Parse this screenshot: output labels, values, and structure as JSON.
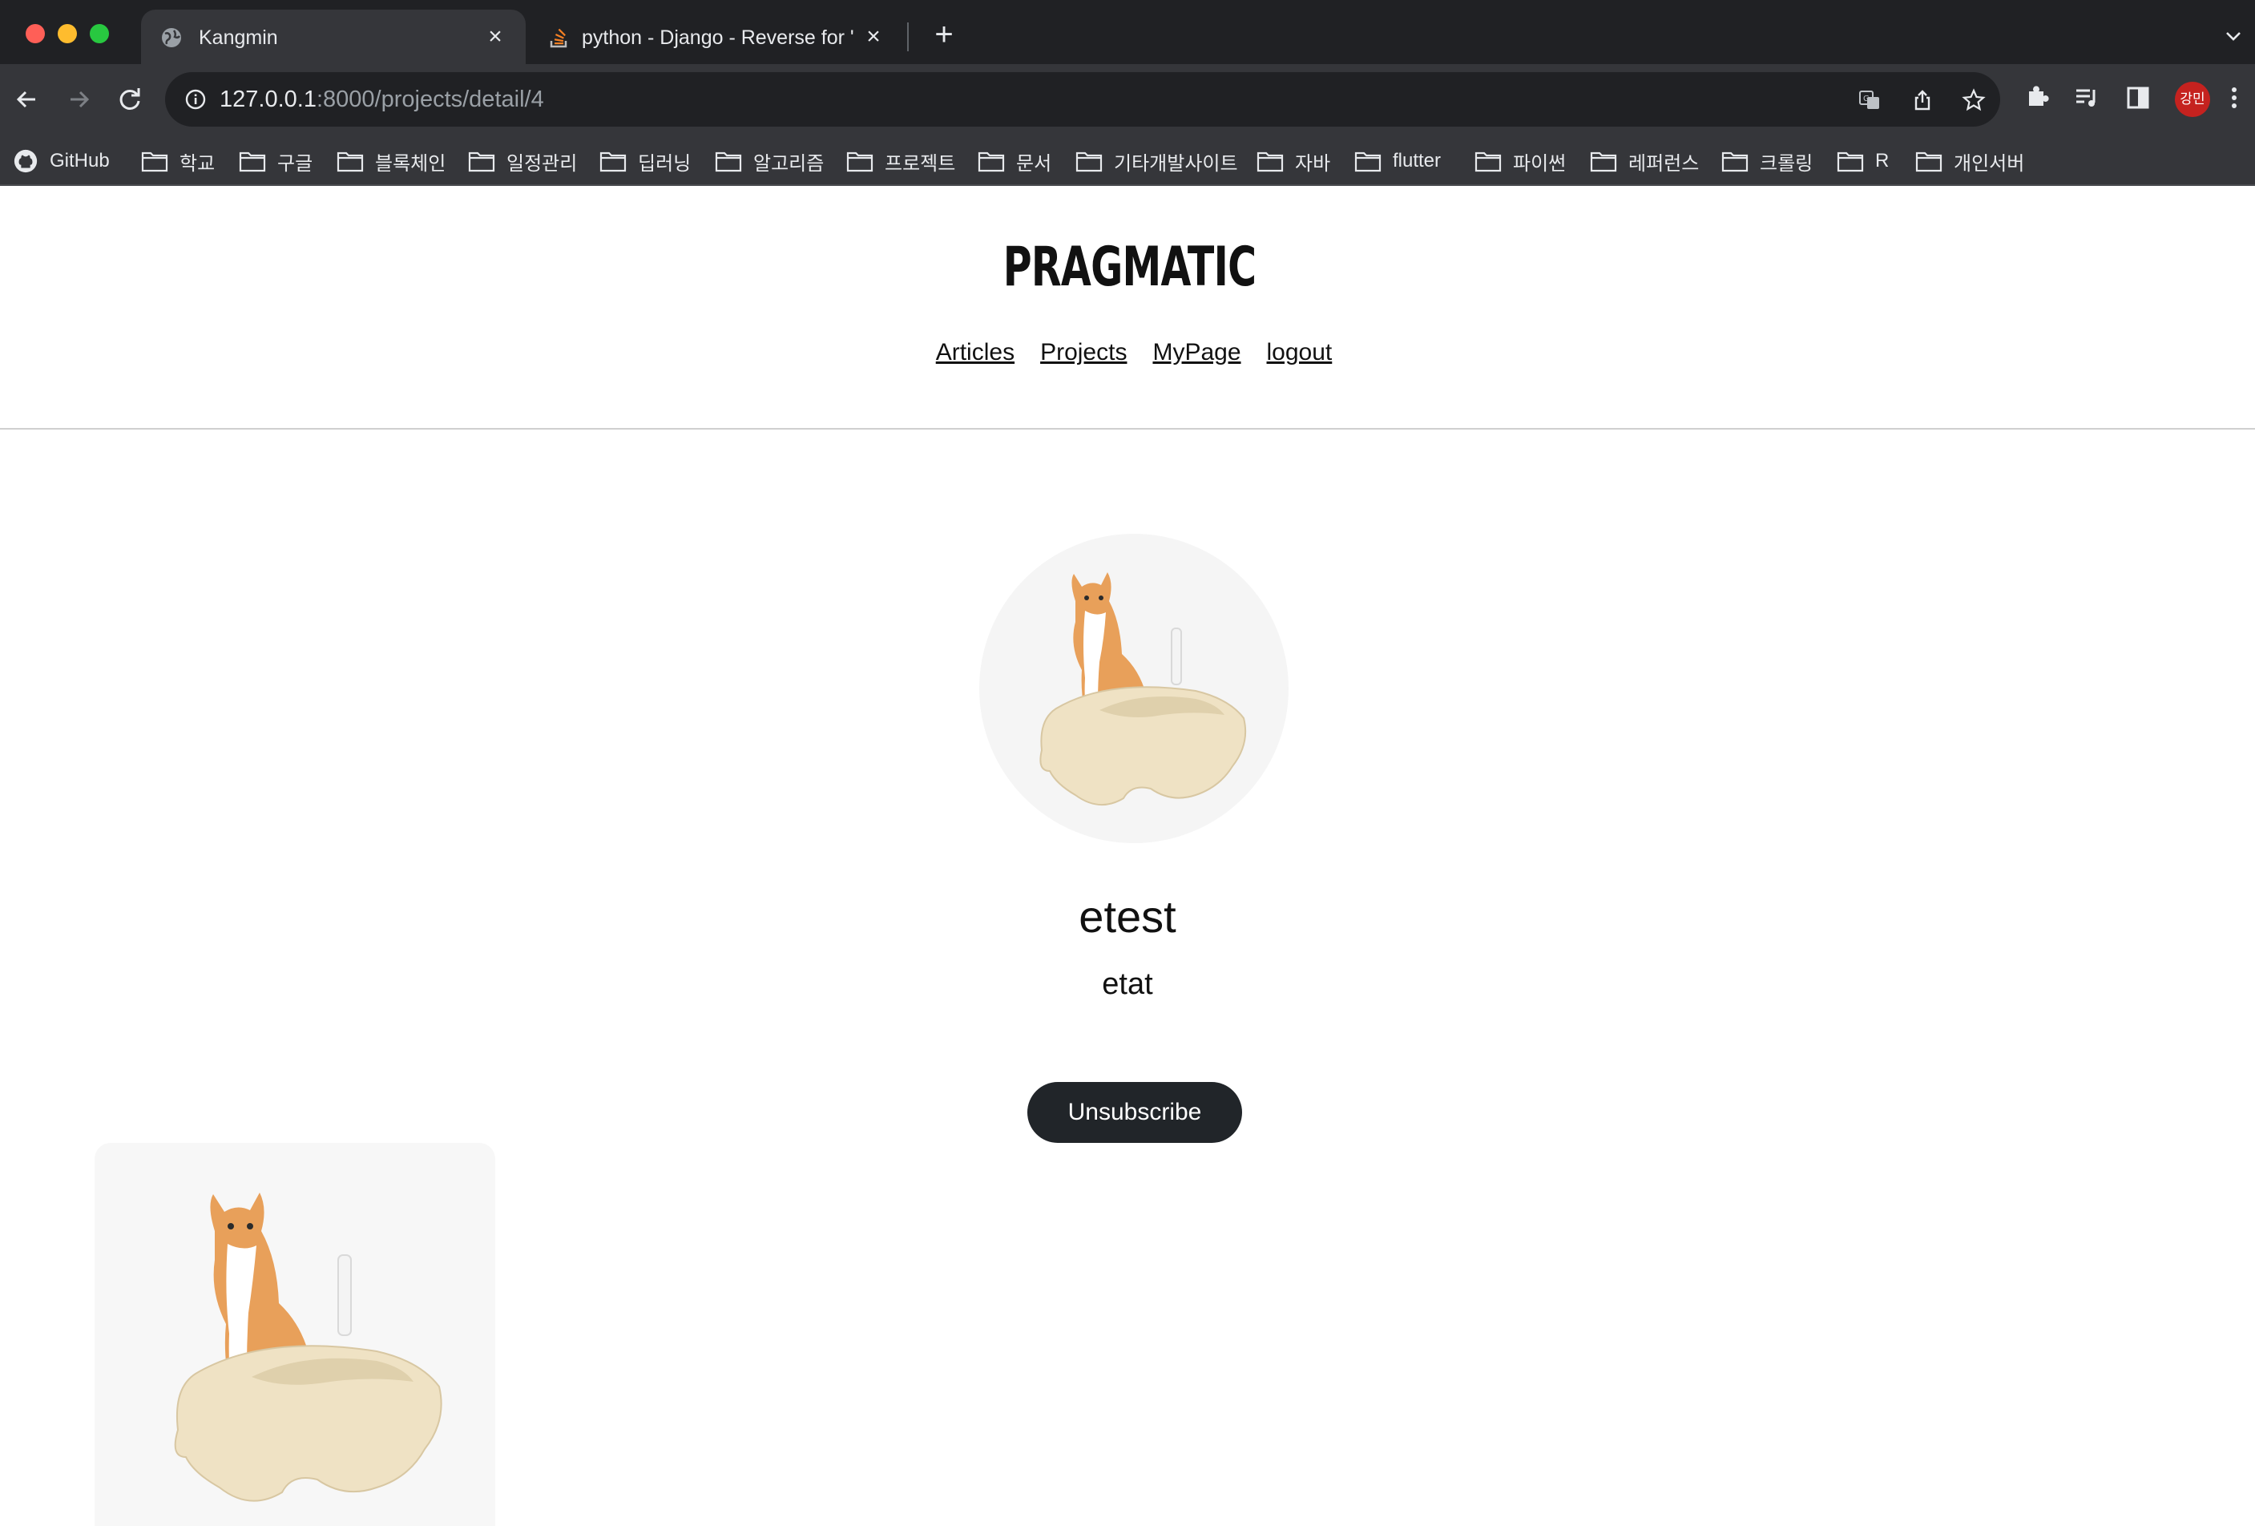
{
  "browser": {
    "tabs": [
      {
        "title": "Kangmin",
        "active": true
      },
      {
        "title": "python - Django - Reverse for '",
        "active": false
      }
    ],
    "url_host": "127.0.0.1",
    "url_rest": ":8000/projects/detail/4",
    "profile_initials": "강민",
    "bookmarks": [
      "GitHub",
      "학교",
      "구글",
      "블록체인",
      "일정관리",
      "딥러닝",
      "알고리즘",
      "프로젝트",
      "문서",
      "기타개발사이트",
      "자바",
      "flutter",
      "파이썬",
      "레퍼런스",
      "크롤링",
      "R",
      "개인서버"
    ]
  },
  "site": {
    "logo": "PRAGMATIC",
    "nav": [
      "Articles",
      "Projects",
      "MyPage",
      "logout"
    ]
  },
  "project": {
    "name": "etest",
    "description": "etat",
    "subscribe_label": "Unsubscribe"
  },
  "colors": {
    "button_bg": "#212529",
    "chrome_dark": "#202124",
    "chrome_mid": "#35363a",
    "avatar_red": "#c5221f"
  }
}
